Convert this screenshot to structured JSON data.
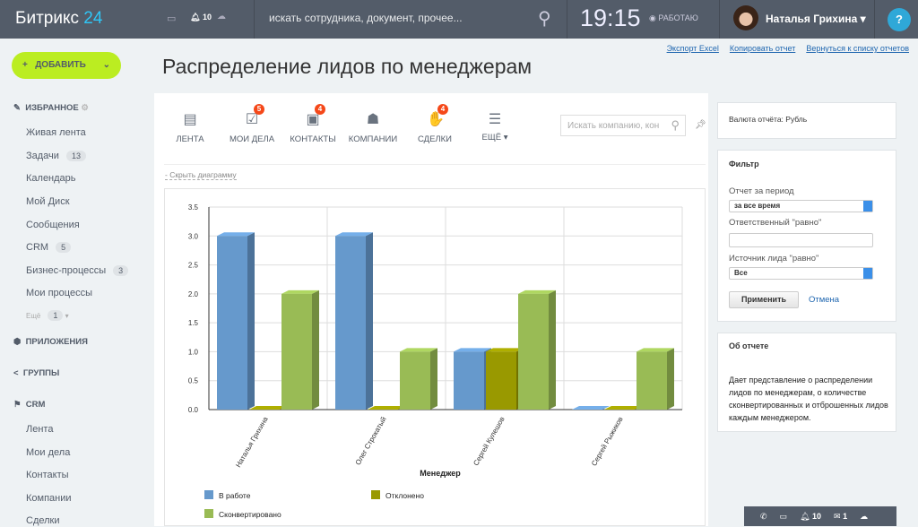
{
  "header": {
    "logo": "Битрикс",
    "logo_num": "24",
    "notif_count": "10",
    "search_placeholder": "искать сотрудника, документ, прочее...",
    "time": "19:15",
    "status": "РАБОТАЮ",
    "user": "Наталья Грихина",
    "help": "?"
  },
  "links": [
    "Экспорт Excel",
    "Копировать отчет",
    "Вернуться к списку отчетов"
  ],
  "sidebar": {
    "add": "ДОБАВИТЬ",
    "favorites": "ИЗБРАННОЕ",
    "items": [
      {
        "label": "Живая лента"
      },
      {
        "label": "Задачи",
        "badge": "13"
      },
      {
        "label": "Календарь"
      },
      {
        "label": "Мой Диск"
      },
      {
        "label": "Сообщения"
      },
      {
        "label": "CRM",
        "badge": "5"
      },
      {
        "label": "Бизнес-процессы",
        "badge": "3"
      },
      {
        "label": "Мои процессы"
      }
    ],
    "more": "Ещё",
    "more_badge": "1",
    "apps": "ПРИЛОЖЕНИЯ",
    "groups": "ГРУППЫ",
    "crm": "CRM",
    "crm_items": [
      "Лента",
      "Мои дела",
      "Контакты",
      "Компании",
      "Сделки"
    ]
  },
  "page_title": "Распределение лидов по менеджерам",
  "toolbar": [
    {
      "label": "ЛЕНТА"
    },
    {
      "label": "МОИ ДЕЛА",
      "count": "5"
    },
    {
      "label": "КОНТАКТЫ",
      "count": "4"
    },
    {
      "label": "КОМПАНИИ"
    },
    {
      "label": "СДЕЛКИ",
      "count": "4"
    },
    {
      "label": "ЕЩЁ ▾"
    }
  ],
  "crm_search_placeholder": "Искать компанию, кон",
  "hide_chart": "- Скрыть диаграмму",
  "right": {
    "currency": "Валюта отчёта: Рубль",
    "filter_title": "Фильтр",
    "period_label": "Отчет за период",
    "period_value": "за все время",
    "resp_label": "Ответственный \"равно\"",
    "resp_value": "",
    "source_label": "Источник лида \"равно\"",
    "source_value": "Все",
    "apply": "Применить",
    "cancel": "Отмена",
    "about_title": "Об отчете",
    "about_text": "Дает представление о распределении лидов по менеджерам, о количестве сконвертированных и отброшенных лидов каждым менеджером."
  },
  "bottom_bar": {
    "notif": "10",
    "mail": "1"
  },
  "chart_data": {
    "type": "bar",
    "categories": [
      "Наталья Грихина",
      "Олег Строкатый",
      "Сергей Кулешов",
      "Сергей Рыжиков"
    ],
    "series": [
      {
        "name": "В работе",
        "values": [
          3,
          3,
          1,
          0
        ],
        "color": "#6699cc"
      },
      {
        "name": "Отклонено",
        "values": [
          0,
          0,
          1,
          0
        ],
        "color": "#999900"
      },
      {
        "name": "Сконвертировано",
        "values": [
          2,
          1,
          2,
          1
        ],
        "color": "#99bb55"
      }
    ],
    "xlabel": "Менеджер",
    "ylabel": "",
    "ylim": [
      0,
      3.5
    ],
    "yticks": [
      "0.0",
      "0.5",
      "1.0",
      "1.5",
      "2.0",
      "2.5",
      "3.0",
      "3.5"
    ],
    "grid": true,
    "legend": "bottom"
  }
}
